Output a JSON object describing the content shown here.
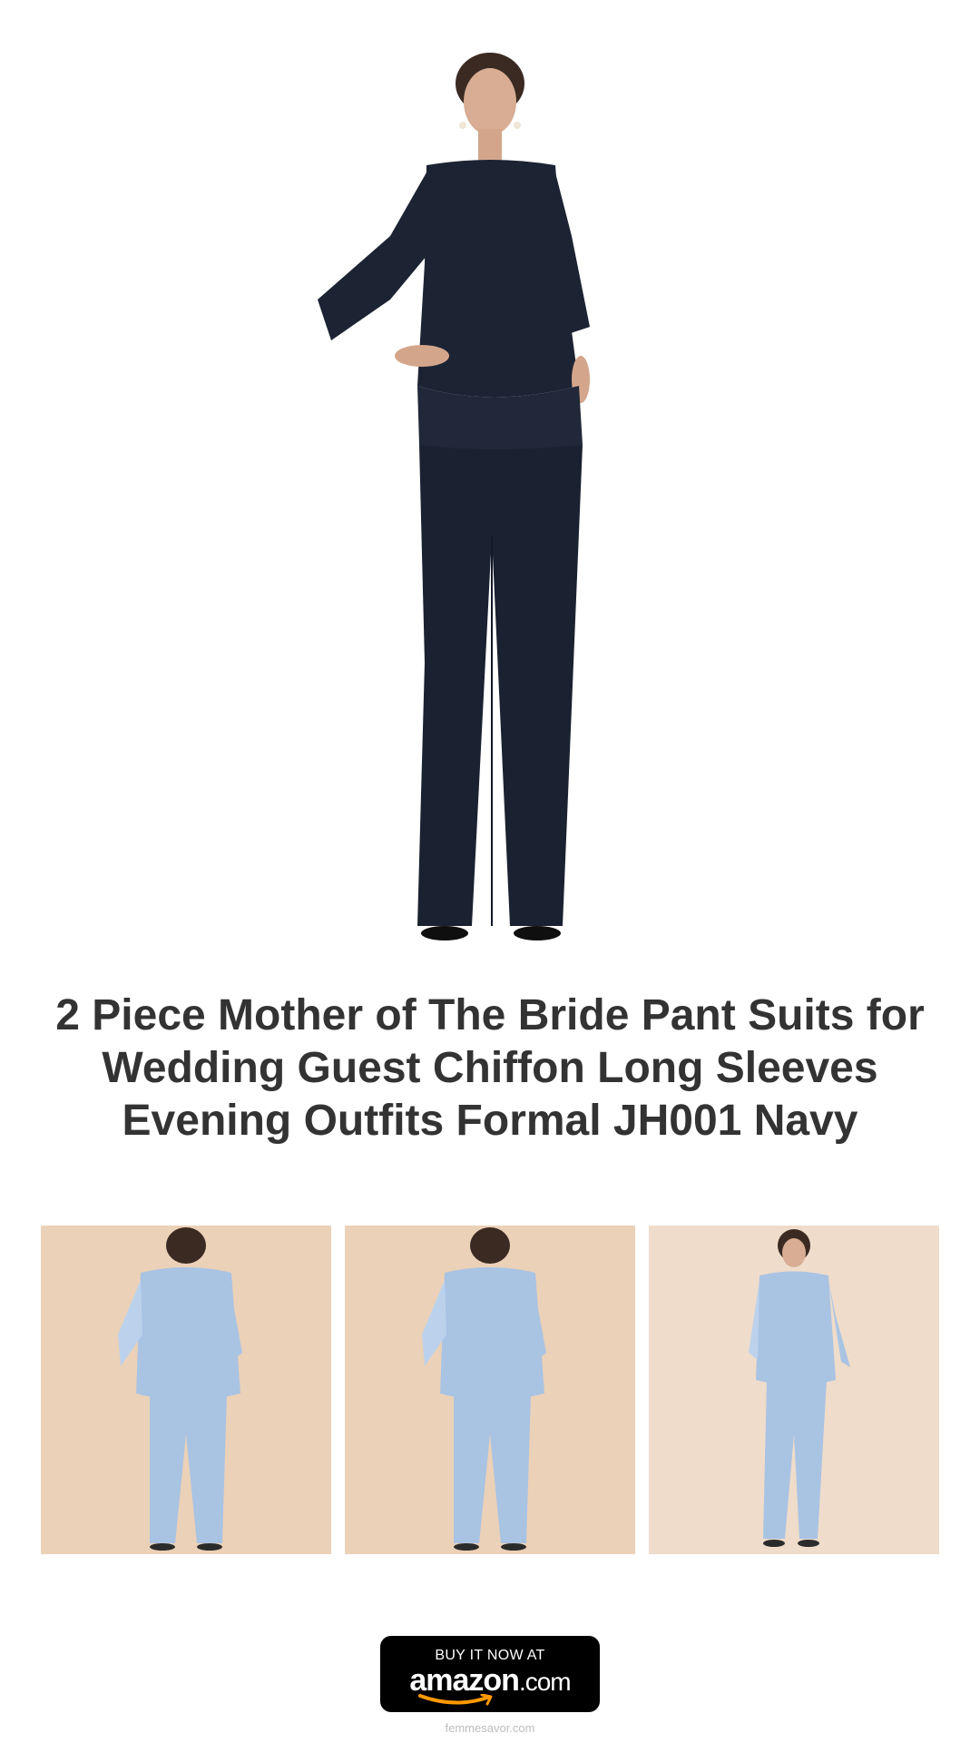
{
  "product": {
    "title": "2 Piece Mother of The Bride Pant Suits for Wedding Guest Chiffon Long Sleeves Evening Outfits Formal JH001 Navy",
    "main_image": {
      "icon": "product-photo-navy-suit",
      "color": "#1c2333"
    },
    "thumbnails": [
      {
        "icon": "product-photo-back-view",
        "color": "#a9c3e3",
        "background": "#ebd1b8"
      },
      {
        "icon": "product-photo-back-view",
        "color": "#a9c3e3",
        "background": "#ebd1b8"
      },
      {
        "icon": "product-photo-front-view",
        "color": "#a9c3e3",
        "background": "#efdcca"
      }
    ]
  },
  "cta": {
    "buy_label": "BUY IT NOW AT",
    "logo_text": "amazon",
    "logo_suffix": ".com",
    "accent": "#ff9900"
  },
  "footer": {
    "site": "femmesavor.com"
  }
}
